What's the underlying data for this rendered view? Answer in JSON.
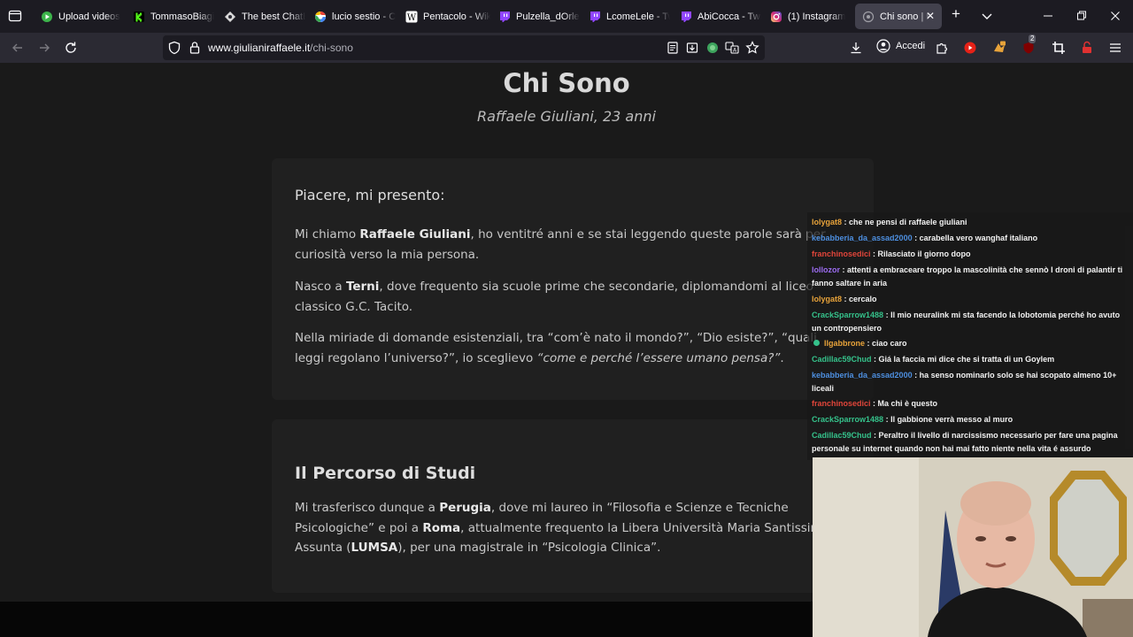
{
  "tabs": [
    {
      "title": "Upload videos",
      "icon": "youtube-studio-icon",
      "active": false
    },
    {
      "title": "TommasoBiagi",
      "icon": "kick-icon",
      "active": false
    },
    {
      "title": "The best ChatB",
      "icon": "chatbot-icon",
      "active": false
    },
    {
      "title": "lucio sestio - Co",
      "icon": "google-icon",
      "active": false
    },
    {
      "title": "Pentacolo - Wiki",
      "icon": "wikipedia-icon",
      "active": false
    },
    {
      "title": "Pulzella_dOrlea",
      "icon": "twitch-icon",
      "active": false
    },
    {
      "title": "LcomeLele - Tw",
      "icon": "twitch-icon",
      "active": false
    },
    {
      "title": "AbiCocca - Twit",
      "icon": "twitch-icon",
      "active": false
    },
    {
      "title": "(1) Instagram",
      "icon": "instagram-icon",
      "active": false
    },
    {
      "title": "Chi sono | Ra",
      "icon": "website-icon",
      "active": true
    }
  ],
  "navbar": {
    "url_domain": "www.giulianiraffaele.it",
    "url_path": "/chi-sono",
    "accedi_label": "Accedi",
    "notification_badge": "2"
  },
  "page": {
    "title": "Chi Sono",
    "subtitle": "Raffaele Giuliani, 23 anni",
    "section1": {
      "heading": "Piacere, mi presento:",
      "p1": [
        {
          "t": "Mi chiamo "
        },
        {
          "t": "Raffaele Giuliani",
          "b": true
        },
        {
          "t": ", ho ventitré anni e se stai leggendo queste parole sarà per curiosità verso la mia persona."
        }
      ],
      "p2": [
        {
          "t": "Nasco a "
        },
        {
          "t": "Terni",
          "b": true
        },
        {
          "t": ", dove frequento sia scuole prime che secondarie, diplomandomi al liceo classico G.C. Tacito."
        }
      ],
      "p3": [
        {
          "t": "Nella miriade di domande esistenziali, tra “com’è nato il mondo?”, “Dio esiste?”, “quali leggi regolano l’universo?”, io sceglievo "
        },
        {
          "t": "“come e perché l’essere umano pensa?”",
          "i": true
        },
        {
          "t": "."
        }
      ]
    },
    "section2": {
      "heading": "Il Percorso di Studi",
      "p1": [
        {
          "t": "Mi trasferisco dunque a "
        },
        {
          "t": "Perugia",
          "b": true
        },
        {
          "t": ", dove mi laureo in “Filosofia e Scienze e Tecniche Psicologiche” e poi a "
        },
        {
          "t": "Roma",
          "b": true
        },
        {
          "t": ", attualmente frequento la Libera Università Maria Santissima Assunta ("
        },
        {
          "t": "LUMSA",
          "b": true
        },
        {
          "t": "), per una magistrale in “Psicologia Clinica”."
        }
      ]
    }
  },
  "chat": [
    {
      "user": "lolygat8",
      "color": "#e8a33a",
      "text": "che ne pensi di raffaele giuliani"
    },
    {
      "user": "kebabberia_da_assad2000",
      "color": "#4d8fe0",
      "text": "carabella vero wanghaf italiano"
    },
    {
      "user": "franchinosedici",
      "color": "#e0453a",
      "text": "Rilasciato il giorno dopo"
    },
    {
      "user": "lollozor",
      "color": "#9b6cf0",
      "text": "attenti a embraceare troppo la mascolinità che sennò I droni di palantir ti fanno saltare in aria"
    },
    {
      "user": "lolygat8",
      "color": "#e8a33a",
      "text": "cercalo"
    },
    {
      "user": "CrackSparrow1488",
      "color": "#35c28b",
      "text": "Il mio neuralink mi sta facendo la lobotomia perché ho avuto un contropensiero"
    },
    {
      "user": "Ilgabbrone",
      "color": "#e8a33a",
      "text": "ciao caro",
      "badge": true
    },
    {
      "user": "Cadillac59Chud",
      "color": "#35c28b",
      "text": "Giá la faccia mi dice che si tratta di un Goylem"
    },
    {
      "user": "kebabberia_da_assad2000",
      "color": "#4d8fe0",
      "text": "ha senso nominarlo solo se hai scopato almeno 10+ liceali"
    },
    {
      "user": "franchinosedici",
      "color": "#e0453a",
      "text": "Ma chi è questo"
    },
    {
      "user": "CrackSparrow1488",
      "color": "#35c28b",
      "text": "Il gabbione verrà messo al muro"
    },
    {
      "user": "Cadillac59Chud",
      "color": "#35c28b",
      "text": "Peraltro il livello di narcissismo necessario per fare una pagina personale su internet quando non hai mai fatto niente nella vita é assurdo"
    }
  ]
}
